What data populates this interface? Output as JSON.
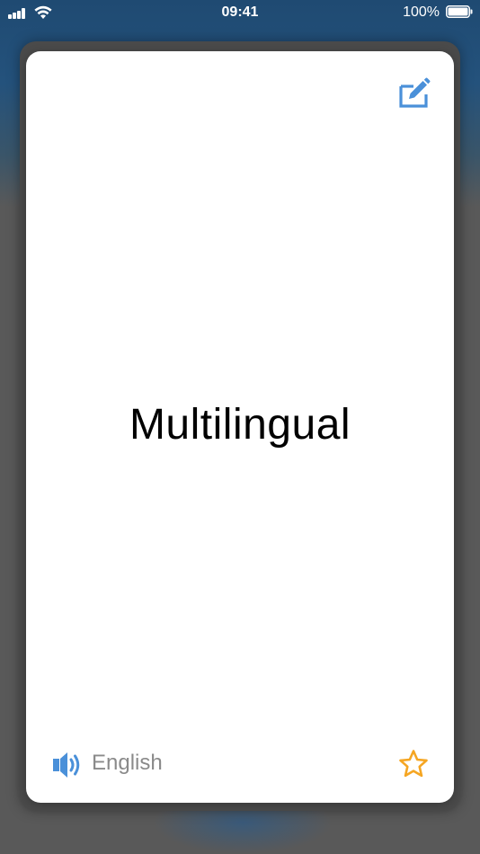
{
  "status_bar": {
    "time": "09:41",
    "battery_percent": "100%"
  },
  "card": {
    "word": "Multilingual",
    "language": "English",
    "favorited": false
  },
  "icons": {
    "edit": "edit-icon",
    "speaker": "speaker-icon",
    "star": "star-outline-icon"
  },
  "colors": {
    "accent_blue": "#4a90d9",
    "star_orange": "#f5a623",
    "label_gray": "#8a8a8a"
  }
}
